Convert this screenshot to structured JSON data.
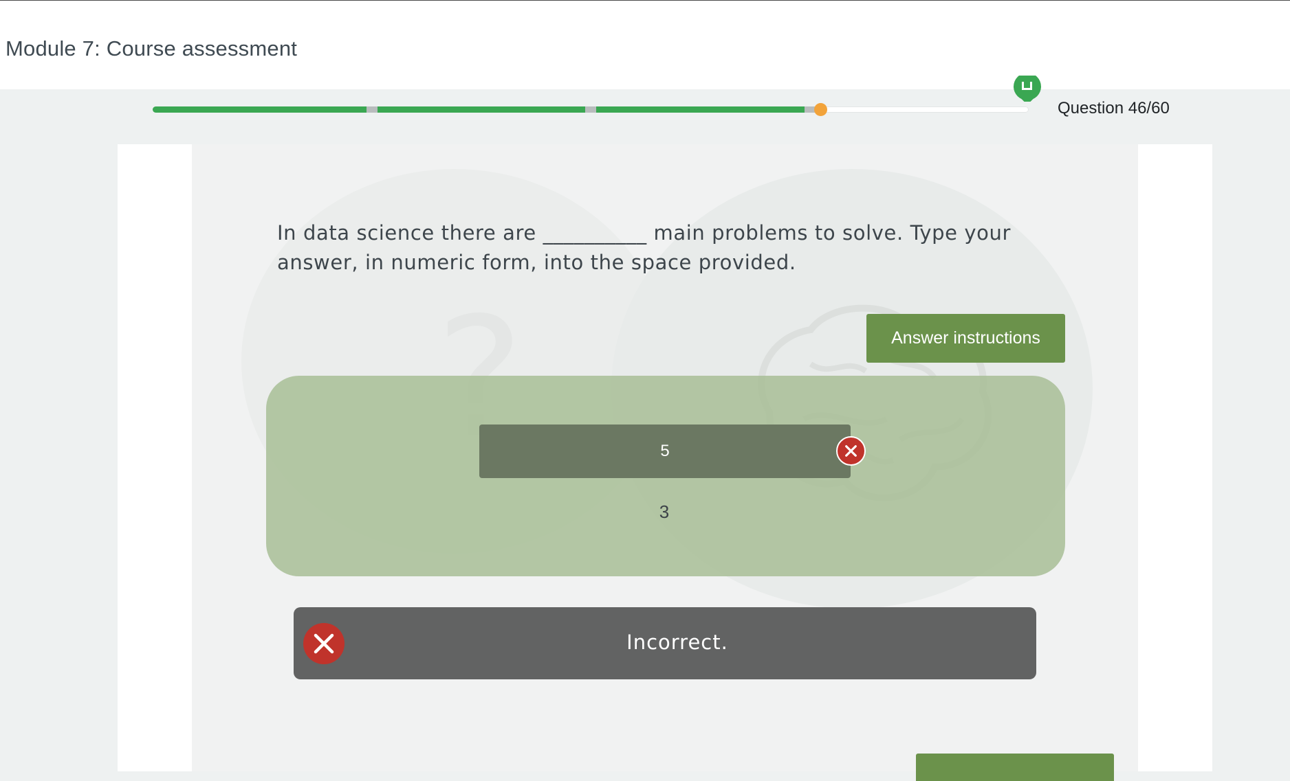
{
  "header": {
    "title": "Module 7: Course assessment"
  },
  "progress": {
    "fraction": 0.762,
    "segment_separators": [
      0.25,
      0.5,
      0.75
    ],
    "counter": "Question 46/60",
    "track_color": "#ffffff",
    "fill_color": "#3aa752",
    "knob_color": "#f2a33a",
    "flag_icon": "flag-marker-icon"
  },
  "question": {
    "text": "In data science there are __________ main problems to solve. Type your answer, in numeric form, into the space provided."
  },
  "instructions_button": {
    "label": "Answer instructions"
  },
  "answer": {
    "entered_value": "5",
    "correct_value": "3",
    "status_icon": "error-x-icon"
  },
  "feedback": {
    "text": "Incorrect.",
    "icon": "error-x-icon"
  },
  "colors": {
    "accent_green": "#6b924b",
    "error_red": "#c0332b",
    "feedback_bg": "#626363"
  }
}
